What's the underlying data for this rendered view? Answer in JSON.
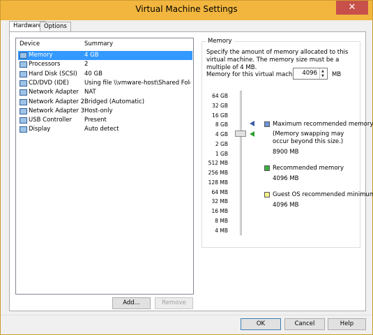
{
  "window": {
    "title": "Virtual Machine Settings",
    "close_glyph": "✕"
  },
  "tabs": [
    {
      "label": "Hardware"
    },
    {
      "label": "Options"
    }
  ],
  "device_list": {
    "headers": {
      "device": "Device",
      "summary": "Summary"
    },
    "rows": [
      {
        "device": "Memory",
        "summary": "4 GB",
        "icon": "memory-icon"
      },
      {
        "device": "Processors",
        "summary": "2",
        "icon": "processor-icon"
      },
      {
        "device": "Hard Disk (SCSI)",
        "summary": "40 GB",
        "icon": "hard-disk-icon"
      },
      {
        "device": "CD/DVD (IDE)",
        "summary": "Using file \\\\vmware-host\\Shared Folde...",
        "icon": "cd-dvd-icon"
      },
      {
        "device": "Network Adapter",
        "summary": "NAT",
        "icon": "network-adapter-icon"
      },
      {
        "device": "Network Adapter 2",
        "summary": "Bridged (Automatic)",
        "icon": "network-adapter-icon"
      },
      {
        "device": "Network Adapter 3",
        "summary": "Host-only",
        "icon": "network-adapter-icon"
      },
      {
        "device": "USB Controller",
        "summary": "Present",
        "icon": "usb-controller-icon"
      },
      {
        "device": "Display",
        "summary": "Auto detect",
        "icon": "display-icon"
      }
    ],
    "add_label": "Add...",
    "remove_label": "Remove"
  },
  "memory": {
    "legend": "Memory",
    "description": "Specify the amount of memory allocated to this virtual machine. The memory size must be a multiple of 4 MB.",
    "field_label": "Memory for this virtual machine:",
    "field_value": "4096",
    "unit": "MB",
    "scale": [
      "64 GB",
      "32 GB",
      "16 GB",
      "8 GB",
      "4 GB",
      "2 GB",
      "1 GB",
      "512 MB",
      "256 MB",
      "128 MB",
      "64 MB",
      "32 MB",
      "16 MB",
      "8 MB",
      "4 MB"
    ],
    "max_label": "Maximum recommended memory",
    "max_note": "(Memory swapping may occur beyond this size.)",
    "max_value": "8900 MB",
    "rec_label": "Recommended memory",
    "rec_value": "4096 MB",
    "guest_label": "Guest OS recommended minimum",
    "guest_value": "4096 MB",
    "colors": {
      "max": "#6e96d6",
      "rec": "#3cb043",
      "guest": "#f4f08a"
    }
  },
  "buttons": {
    "ok": "OK",
    "cancel": "Cancel",
    "help": "Help"
  }
}
